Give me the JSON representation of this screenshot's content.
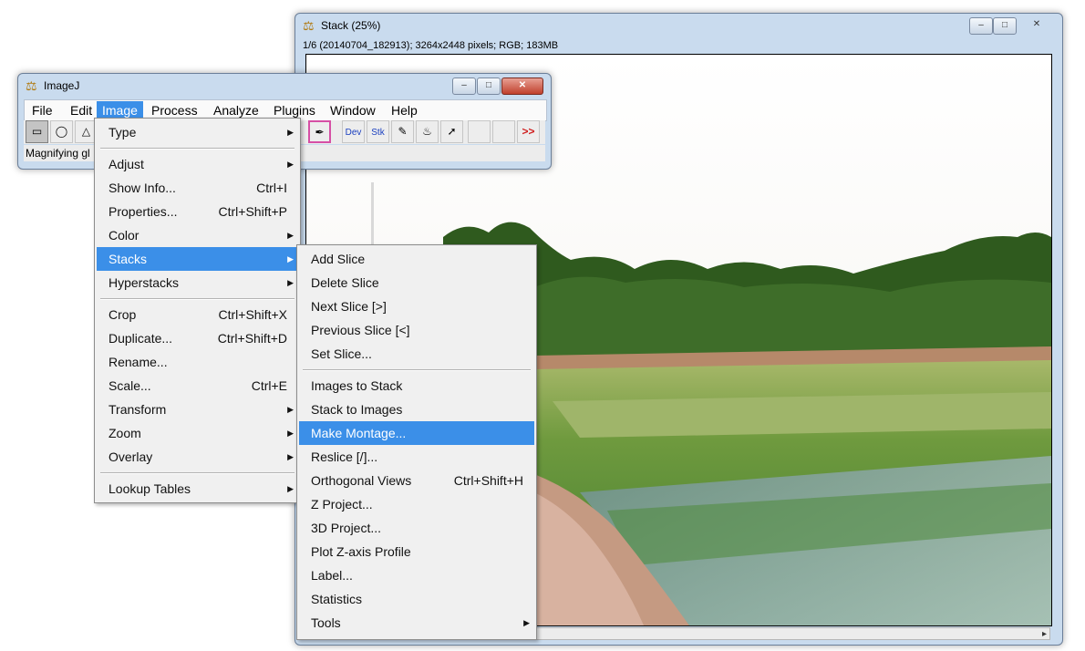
{
  "stack_window": {
    "title": "Stack (25%)",
    "info": "1/6 (20140704_182913); 3264x2448 pixels; RGB; 183MB",
    "controls": {
      "minimize": "–",
      "maximize": "□",
      "close": "✕"
    }
  },
  "imagej_window": {
    "title": "ImageJ",
    "controls": {
      "minimize": "–",
      "maximize": "□",
      "close": "✕"
    },
    "menubar": [
      "File",
      "Edit",
      "Image",
      "Process",
      "Analyze",
      "Plugins",
      "Window",
      "Help"
    ],
    "toolbar": {
      "dev": "Dev",
      "stk": "Stk",
      "more": ">>"
    },
    "status": "Magnifying gl"
  },
  "image_menu": {
    "items": [
      {
        "label": "Type",
        "shortcut": "",
        "submenu": true
      },
      {
        "label": "Adjust",
        "shortcut": "",
        "submenu": true
      },
      {
        "label": "Show Info...",
        "shortcut": "Ctrl+I",
        "submenu": false
      },
      {
        "label": "Properties...",
        "shortcut": "Ctrl+Shift+P",
        "submenu": false
      },
      {
        "label": "Color",
        "shortcut": "",
        "submenu": true
      },
      {
        "label": "Stacks",
        "shortcut": "",
        "submenu": true
      },
      {
        "label": "Hyperstacks",
        "shortcut": "",
        "submenu": true
      },
      {
        "label": "Crop",
        "shortcut": "Ctrl+Shift+X",
        "submenu": false
      },
      {
        "label": "Duplicate...",
        "shortcut": "Ctrl+Shift+D",
        "submenu": false
      },
      {
        "label": "Rename...",
        "shortcut": "",
        "submenu": false
      },
      {
        "label": "Scale...",
        "shortcut": "Ctrl+E",
        "submenu": false
      },
      {
        "label": "Transform",
        "shortcut": "",
        "submenu": true
      },
      {
        "label": "Zoom",
        "shortcut": "",
        "submenu": true
      },
      {
        "label": "Overlay",
        "shortcut": "",
        "submenu": true
      },
      {
        "label": "Lookup Tables",
        "shortcut": "",
        "submenu": true
      }
    ],
    "highlighted": "Stacks"
  },
  "stacks_menu": {
    "items": [
      {
        "label": "Add Slice",
        "shortcut": "",
        "submenu": false
      },
      {
        "label": "Delete Slice",
        "shortcut": "",
        "submenu": false
      },
      {
        "label": "Next Slice [>]",
        "shortcut": "",
        "submenu": false
      },
      {
        "label": "Previous Slice [<]",
        "shortcut": "",
        "submenu": false
      },
      {
        "label": "Set Slice...",
        "shortcut": "",
        "submenu": false
      },
      {
        "label": "Images to Stack",
        "shortcut": "",
        "submenu": false
      },
      {
        "label": "Stack to Images",
        "shortcut": "",
        "submenu": false
      },
      {
        "label": "Make Montage...",
        "shortcut": "",
        "submenu": false
      },
      {
        "label": "Reslice [/]...",
        "shortcut": "",
        "submenu": false
      },
      {
        "label": "Orthogonal Views",
        "shortcut": "Ctrl+Shift+H",
        "submenu": false
      },
      {
        "label": "Z Project...",
        "shortcut": "",
        "submenu": false
      },
      {
        "label": "3D Project...",
        "shortcut": "",
        "submenu": false
      },
      {
        "label": "Plot Z-axis Profile",
        "shortcut": "",
        "submenu": false
      },
      {
        "label": "Label...",
        "shortcut": "",
        "submenu": false
      },
      {
        "label": "Statistics",
        "shortcut": "",
        "submenu": false
      },
      {
        "label": "Tools",
        "shortcut": "",
        "submenu": true
      }
    ],
    "highlighted": "Make Montage..."
  },
  "colors": {
    "highlight": "#3b8fe8",
    "menu_bg": "#f0f0f0",
    "window_frame": "#c9dbee"
  },
  "icons": {
    "app": "microscope-icon",
    "submenu": "triangle-right-icon"
  }
}
